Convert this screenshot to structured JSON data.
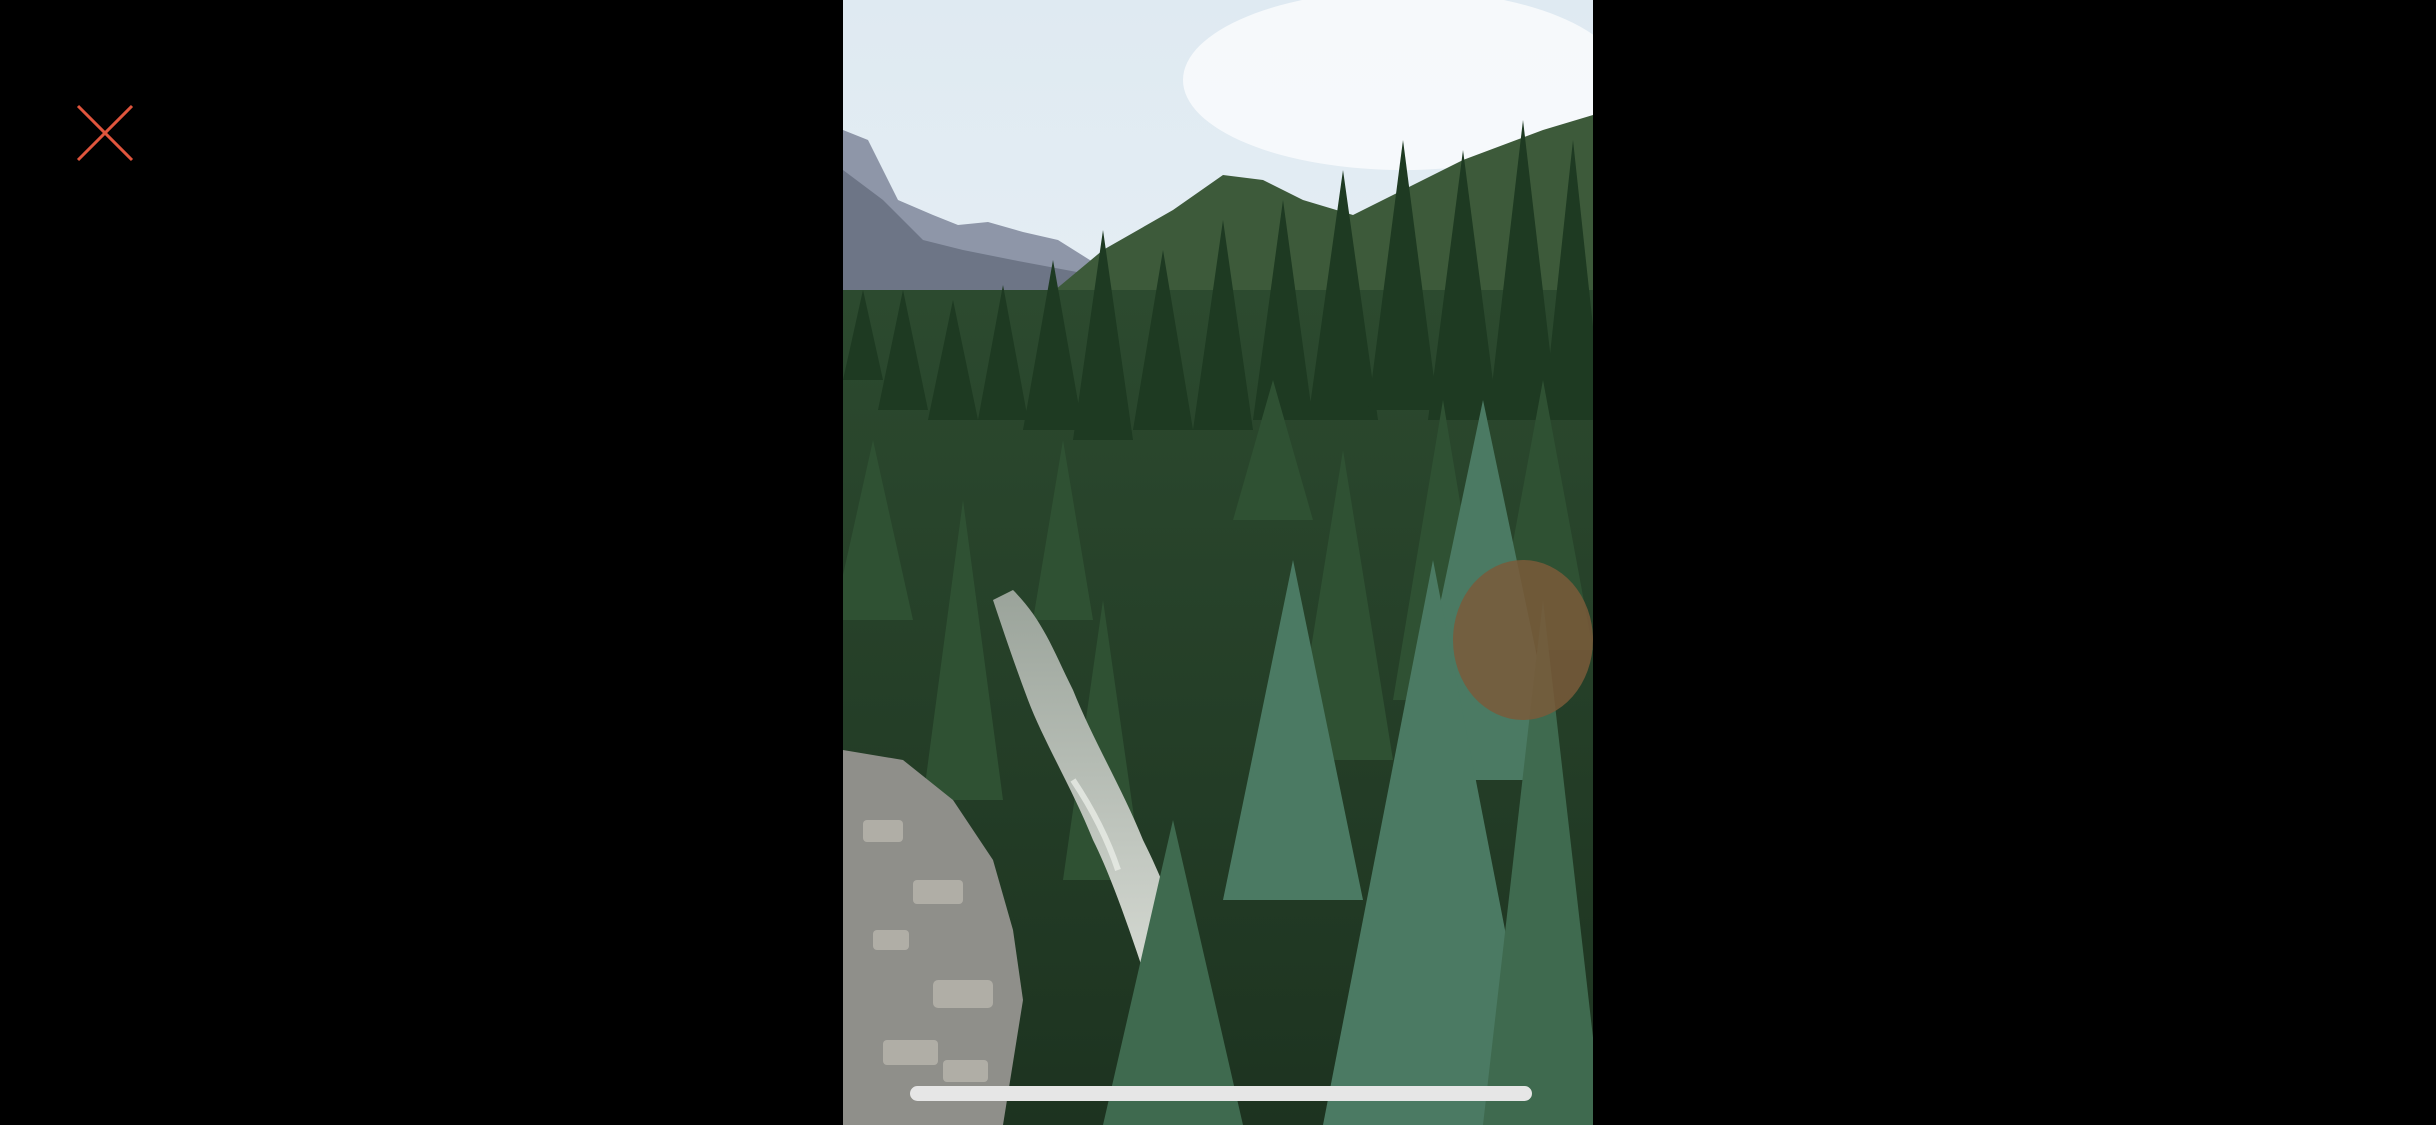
{
  "viewer": {
    "close_icon": "close-icon",
    "accent_color": "#e0553d",
    "background": "#000000"
  },
  "photo": {
    "subject": "mountain-forest-river-photo"
  },
  "home_indicator": {
    "color": "#e6e6e6"
  }
}
